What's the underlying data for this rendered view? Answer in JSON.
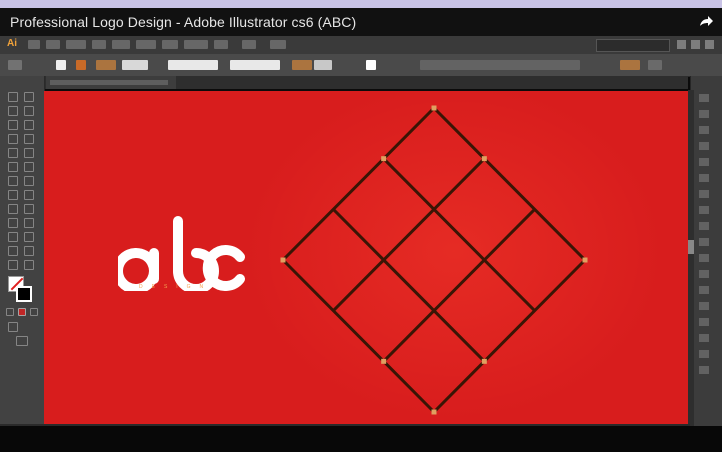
{
  "video": {
    "title": "Professional Logo Design - Adobe Illustrator cs6 (ABC)",
    "share_icon": "share-arrow-icon"
  },
  "app": {
    "logo_text": "Ai",
    "accent": "#f0a23a"
  },
  "canvas": {
    "artboard_color": "#d81d1d",
    "grid_stroke": "#3a1505",
    "anchor_color": "#e0a060"
  },
  "logo": {
    "wordmark": "abc",
    "tagline": "DESIGN",
    "wordmark_color": "#ffffff",
    "tagline_color": "#f4a050"
  }
}
